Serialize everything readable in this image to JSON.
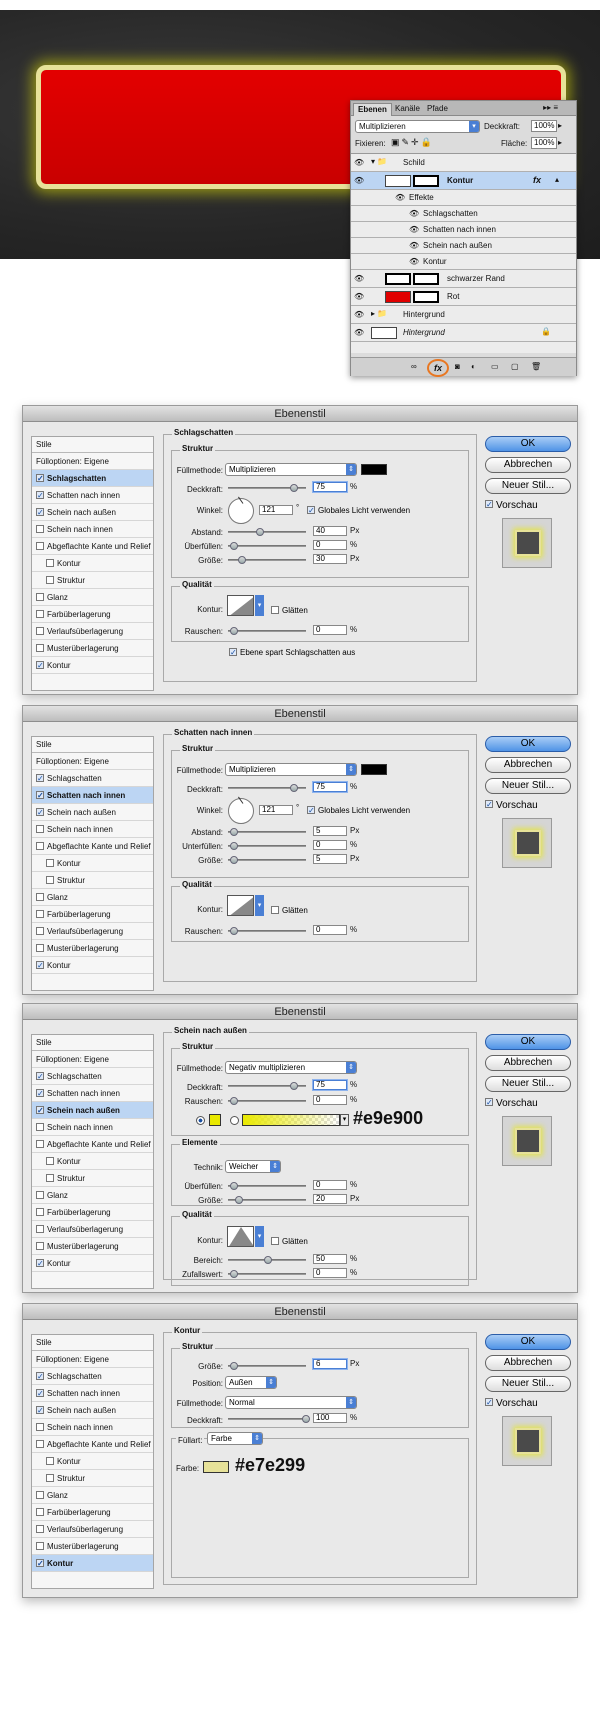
{
  "layers_panel": {
    "tabs": [
      "Ebenen",
      "Kanäle",
      "Pfade"
    ],
    "blend_mode": "Multiplizieren",
    "opacity_label": "Deckkraft:",
    "opacity": "100%",
    "lock_label": "Fixieren:",
    "fill_label": "Fläche:",
    "fill": "100%",
    "rows": {
      "schild": "Schild",
      "kontur": "Kontur",
      "effekte": "Effekte",
      "e1": "Schlagschatten",
      "e2": "Schatten nach innen",
      "e3": "Schein nach außen",
      "e4": "Kontur",
      "schwarzer": "schwarzer Rand",
      "rot": "Rot",
      "hintergrund_group": "Hintergrund",
      "hintergrund": "Hintergrund"
    },
    "fx_label": "fx",
    "accent": "#e87722"
  },
  "common": {
    "title": "Ebenenstil",
    "stile": "Stile",
    "fuelloptionen": "Fülloptionen: Eigene",
    "items": [
      "Schlagschatten",
      "Schatten nach innen",
      "Schein nach außen",
      "Schein nach innen",
      "Abgeflachte Kante und Relief",
      "Kontur",
      "Struktur",
      "Glanz",
      "Farbüberlagerung",
      "Verlaufsüberlagerung",
      "Musterüberlagerung",
      "Kontur"
    ],
    "ok": "OK",
    "abbrechen": "Abbrechen",
    "neuer_stil": "Neuer Stil...",
    "vorschau": "Vorschau",
    "struktur": "Struktur",
    "qualitaet": "Qualität",
    "fuellmethode": "Füllmethode:",
    "deckkraft": "Deckkraft:",
    "winkel": "Winkel:",
    "globales": "Globales Licht verwenden",
    "kontur_lbl": "Kontur:",
    "glaetten": "Glätten",
    "px": "Px",
    "pct": "%",
    "deg": "°"
  },
  "dlg1": {
    "section": "Schlagschatten",
    "blend": "Multiplizieren",
    "opacity": "75",
    "angle": "121",
    "abstand_lbl": "Abstand:",
    "abstand": "40",
    "ueber_lbl": "Überfüllen:",
    "ueber": "0",
    "groesse_lbl": "Größe:",
    "groesse": "30",
    "rauschen_lbl": "Rauschen:",
    "rauschen": "0",
    "spart": "Ebene spart Schlagschatten aus",
    "color": "#000000"
  },
  "dlg2": {
    "section": "Schatten nach innen",
    "blend": "Multiplizieren",
    "opacity": "75",
    "angle": "121",
    "abstand_lbl": "Abstand:",
    "abstand": "5",
    "unter_lbl": "Unterfüllen:",
    "unter": "0",
    "groesse_lbl": "Größe:",
    "groesse": "5",
    "rauschen_lbl": "Rauschen:",
    "rauschen": "0",
    "color": "#000000"
  },
  "dlg3": {
    "section": "Schein nach außen",
    "blend": "Negativ multiplizieren",
    "opacity": "75",
    "rauschen_lbl": "Rauschen:",
    "rauschen": "0",
    "hex": "#e9e900",
    "elemente": "Elemente",
    "technik_lbl": "Technik:",
    "technik": "Weicher",
    "ueber_lbl": "Überfüllen:",
    "ueber": "0",
    "groesse_lbl": "Größe:",
    "groesse": "20",
    "bereich_lbl": "Bereich:",
    "bereich": "50",
    "zufall_lbl": "Zufallswert:",
    "zufall": "0",
    "color": "#e9e900"
  },
  "dlg4": {
    "section": "Kontur",
    "groesse_lbl": "Größe:",
    "groesse": "6",
    "position_lbl": "Position:",
    "position": "Außen",
    "blend": "Normal",
    "opacity": "100",
    "fuellart_lbl": "Füllart:",
    "fuellart": "Farbe",
    "farbe_lbl": "Farbe:",
    "hex": "#e7e299",
    "color": "#e7e299"
  }
}
